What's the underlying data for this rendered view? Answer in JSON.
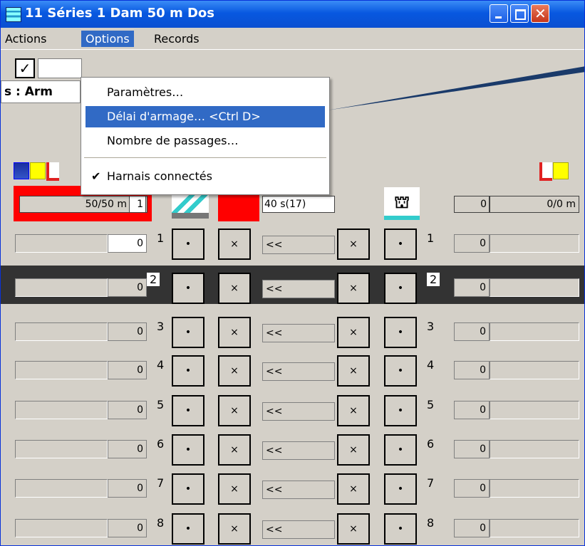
{
  "window": {
    "title": "11 Séries 1  Dam 50 m Dos"
  },
  "menubar": {
    "items": [
      "Actions",
      "Options",
      "Records"
    ]
  },
  "toolbar": {
    "check": "✓"
  },
  "status": {
    "label": "s : Arm"
  },
  "options_menu": {
    "items": [
      {
        "label": "Paramètres…"
      },
      {
        "label": "Délai d'armage…  <Ctrl D>"
      },
      {
        "label": "Nombre de passages…"
      },
      {
        "label": "Harnais connectés",
        "checked": true
      }
    ]
  },
  "header": {
    "distance": "50/50  m",
    "count": "1",
    "delay": "40 s(17)",
    "right_count": "0",
    "right_distance": "0/0  m"
  },
  "lanes": [
    {
      "num": "1",
      "value": "0",
      "dot": "•",
      "x": "×",
      "field": "<<",
      "right_value": "0"
    },
    {
      "num": "2",
      "value": "0",
      "dot": "•",
      "x": "×",
      "field": "<<",
      "right_value": "0"
    },
    {
      "num": "3",
      "value": "0",
      "dot": "•",
      "x": "×",
      "field": "<<",
      "right_value": "0"
    },
    {
      "num": "4",
      "value": "0",
      "dot": "•",
      "x": "×",
      "field": "<<",
      "right_value": "0"
    },
    {
      "num": "5",
      "value": "0",
      "dot": "•",
      "x": "×",
      "field": "<<",
      "right_value": "0"
    },
    {
      "num": "6",
      "value": "0",
      "dot": "•",
      "x": "×",
      "field": "<<",
      "right_value": "0"
    },
    {
      "num": "7",
      "value": "0",
      "dot": "•",
      "x": "×",
      "field": "<<",
      "right_value": "0"
    },
    {
      "num": "8",
      "value": "0",
      "dot": "•",
      "x": "×",
      "field": "<<",
      "right_value": "0"
    }
  ]
}
